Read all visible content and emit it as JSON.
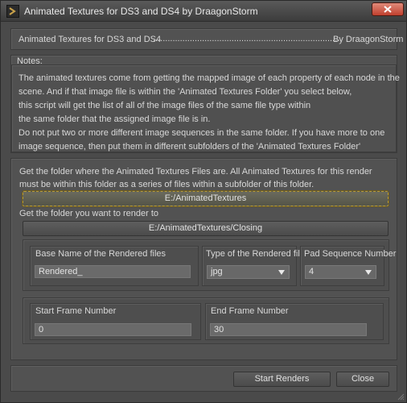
{
  "window": {
    "title": "Animated Textures for DS3 and DS4 by DraagonStorm",
    "close_icon": "close-x-icon",
    "app_icon": "daz-script-icon"
  },
  "header": {
    "left_text": "Animated Textures for DS3 and DS4",
    "dots": "................................................................................................................",
    "right_text": "By DraagonStorm"
  },
  "notes": {
    "label": "Notes:",
    "lines": [
      "The animated textures come from getting the mapped image of each property of each node in the",
      "scene. And if that image file is within the 'Animated Textures Folder' you select below,",
      "this script will get the list of all of the image files of the same file type within",
      "the same folder that the assigned image file is in.",
      "Do not put two or more different image sequences in the same folder. If you have more to one",
      "image sequence, then put them in different subfolders of the 'Animated Textures Folder'"
    ]
  },
  "folders": {
    "source_text_1": "Get the folder where the Animated Textures Files are. All Animated Textures for this render",
    "source_text_2": "must be within this folder as a series of files within a subfolder of this folder.",
    "source_button": "E:/AnimatedTextures",
    "render_text": "Get the folder you want to render to",
    "render_button": "E:/AnimatedTextures/Closing"
  },
  "options": {
    "base_name_label": "Base Name of the Rendered files",
    "base_name_value": "Rendered_",
    "type_label": "Type of the Rendered files",
    "type_value": "jpg",
    "pad_label": "Pad Sequence Number",
    "pad_value": "4"
  },
  "frames": {
    "start_label": "Start Frame Number",
    "start_value": "0",
    "end_label": "End Frame Number",
    "end_value": "30"
  },
  "footer": {
    "start_button": "Start Renders",
    "close_button": "Close"
  }
}
